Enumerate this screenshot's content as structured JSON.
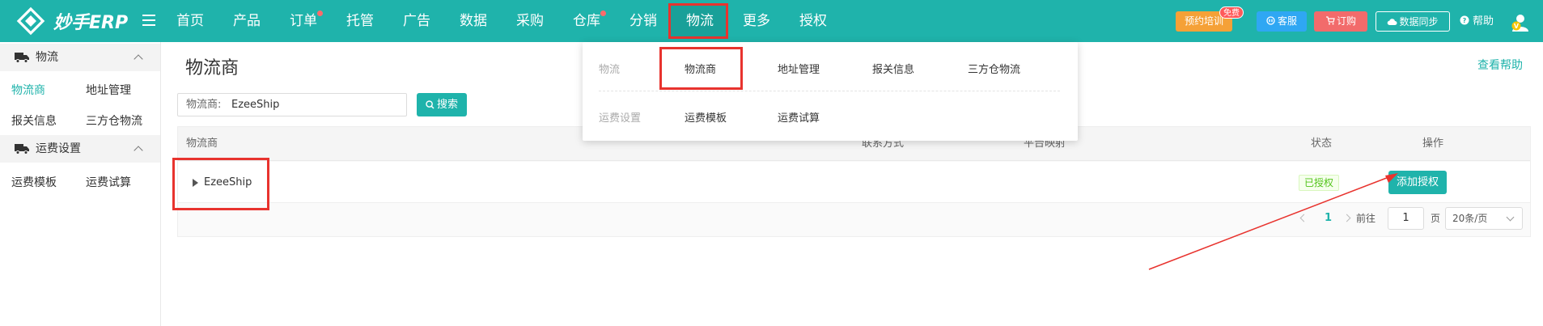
{
  "brand": {
    "name": "妙手ERP"
  },
  "nav": {
    "items": [
      {
        "label": "首页"
      },
      {
        "label": "产品"
      },
      {
        "label": "订单"
      },
      {
        "label": "托管"
      },
      {
        "label": "广告"
      },
      {
        "label": "数据"
      },
      {
        "label": "采购"
      },
      {
        "label": "仓库"
      },
      {
        "label": "分销"
      },
      {
        "label": "物流"
      },
      {
        "label": "更多"
      },
      {
        "label": "授权"
      }
    ],
    "active": "物流"
  },
  "toolbar": {
    "training": "预约培训",
    "free_badge": "免费",
    "service": "客服",
    "order": "订购",
    "sync": "数据同步",
    "help": "帮助"
  },
  "sidebar": {
    "groups": [
      {
        "label": "物流",
        "icon": "truck-icon",
        "links": [
          "物流商",
          "地址管理",
          "报关信息",
          "三方仓物流"
        ]
      },
      {
        "label": "运费设置",
        "icon": "truck-icon",
        "links": [
          "运费模板",
          "运费试算"
        ]
      }
    ],
    "active": "物流商"
  },
  "page": {
    "title": "物流商",
    "help_link": "查看帮助"
  },
  "search": {
    "label": "物流商:",
    "value": "EzeeShip",
    "button": "搜索"
  },
  "table": {
    "columns": [
      "物流商",
      "联系方式",
      "平台映射",
      "状态",
      "操作"
    ],
    "rows": [
      {
        "name": "EzeeShip",
        "status": "已授权",
        "action": "添加授权"
      }
    ]
  },
  "pagination": {
    "current": "1",
    "goto_label": "前往",
    "goto_value": "1",
    "page_unit": "页",
    "page_size": "20条/页"
  },
  "dropdown": {
    "sections": [
      {
        "category": "物流",
        "links": [
          "物流商",
          "地址管理",
          "报关信息",
          "三方仓物流"
        ]
      },
      {
        "category": "运费设置",
        "links": [
          "运费模板",
          "运费试算"
        ]
      }
    ]
  },
  "colors": {
    "primary": "#1fb3ab",
    "highlight": "#e8332e",
    "training": "#f5a137",
    "service": "#2fa7f3",
    "order": "#f26b6b",
    "success": "#52c41a"
  }
}
